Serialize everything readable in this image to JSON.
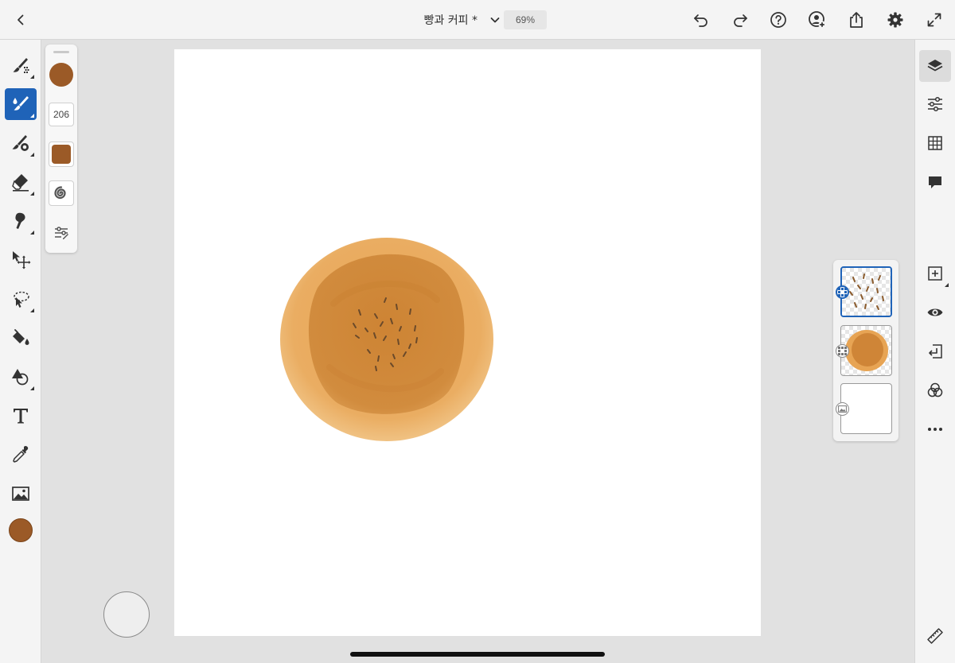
{
  "document": {
    "title": "빵과 커피 *",
    "zoom": "69%"
  },
  "topbar": {
    "icons": [
      "chevron-left-icon",
      "chevron-down-icon",
      "undo-icon",
      "redo-icon",
      "help-icon",
      "invite-icon",
      "share-icon",
      "gear-icon",
      "fullscreen-icon"
    ]
  },
  "left_toolbar": {
    "tools": [
      "paint-brush-tool",
      "pixel-brush-tool",
      "mixer-brush-tool",
      "eraser-tool",
      "smudge-tool",
      "move-tool",
      "lasso-select-tool",
      "fill-tool",
      "shape-tool",
      "text-tool",
      "eyedropper-tool",
      "place-image-tool"
    ],
    "active_tool": "pixel-brush-tool",
    "color": "#9b5a27"
  },
  "brush_panel": {
    "color": "#9b5a27",
    "size": "206",
    "flow_color": "#9b5a27"
  },
  "right_toolbar": {
    "tools": [
      "layers-icon",
      "adjustments-icon",
      "grid-icon",
      "comment-icon",
      "add-layer-icon",
      "visibility-icon",
      "merge-down-icon",
      "blend-mode-icon",
      "more-icon",
      "ruler-icon"
    ],
    "active_tool": "layers-icon"
  },
  "layers": [
    {
      "kind": "pixel-layer",
      "selected": true
    },
    {
      "kind": "pixel-layer",
      "selected": false
    },
    {
      "kind": "image-layer",
      "selected": false
    }
  ],
  "colors": {
    "accent": "#1f63b8",
    "bun_outer": "#e9a85a",
    "bun_inner": "#cf8537",
    "seed": "#6b4a2a"
  }
}
